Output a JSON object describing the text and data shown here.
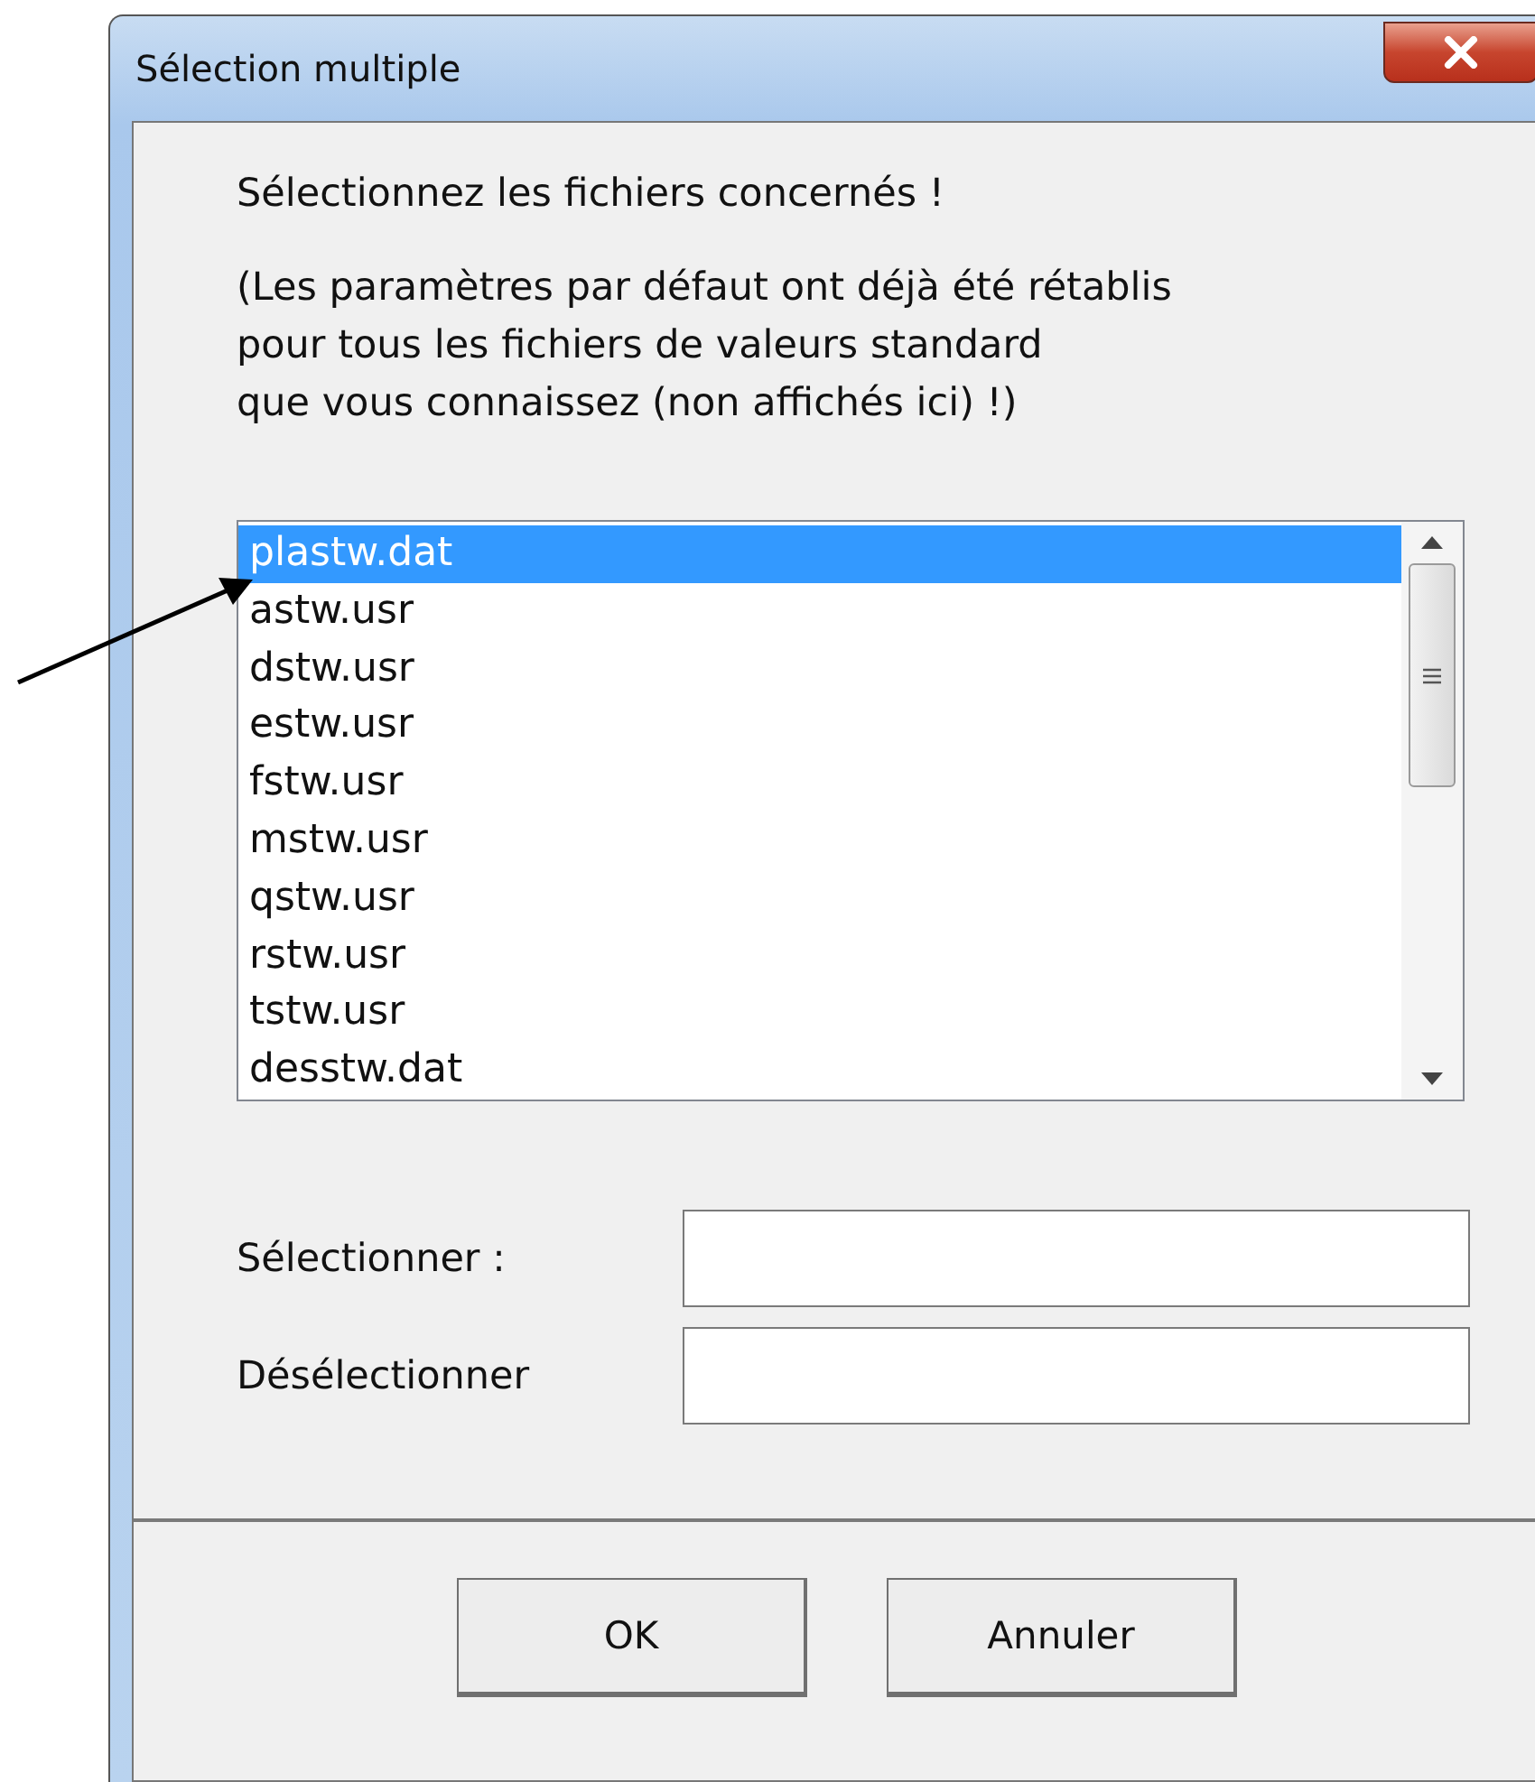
{
  "window": {
    "title": "Sélection multiple"
  },
  "instructions": [
    "Sélectionnez les fichiers concernés !",
    "(Les paramètres par défaut ont déjà été rétablis\npour tous les fichiers de valeurs standard\nque vous connaissez (non affichés ici) !)"
  ],
  "files": [
    {
      "name": "plastw.dat",
      "selected": true
    },
    {
      "name": "astw.usr",
      "selected": false
    },
    {
      "name": "dstw.usr",
      "selected": false
    },
    {
      "name": "estw.usr",
      "selected": false
    },
    {
      "name": "fstw.usr",
      "selected": false
    },
    {
      "name": "mstw.usr",
      "selected": false
    },
    {
      "name": "qstw.usr",
      "selected": false
    },
    {
      "name": "rstw.usr",
      "selected": false
    },
    {
      "name": "tstw.usr",
      "selected": false
    },
    {
      "name": "desstw.dat",
      "selected": false
    }
  ],
  "fields": [
    {
      "label": "Sélectionner :"
    },
    {
      "label": "Désélectionner"
    }
  ],
  "buttons": [
    "OK",
    "Annuler"
  ]
}
